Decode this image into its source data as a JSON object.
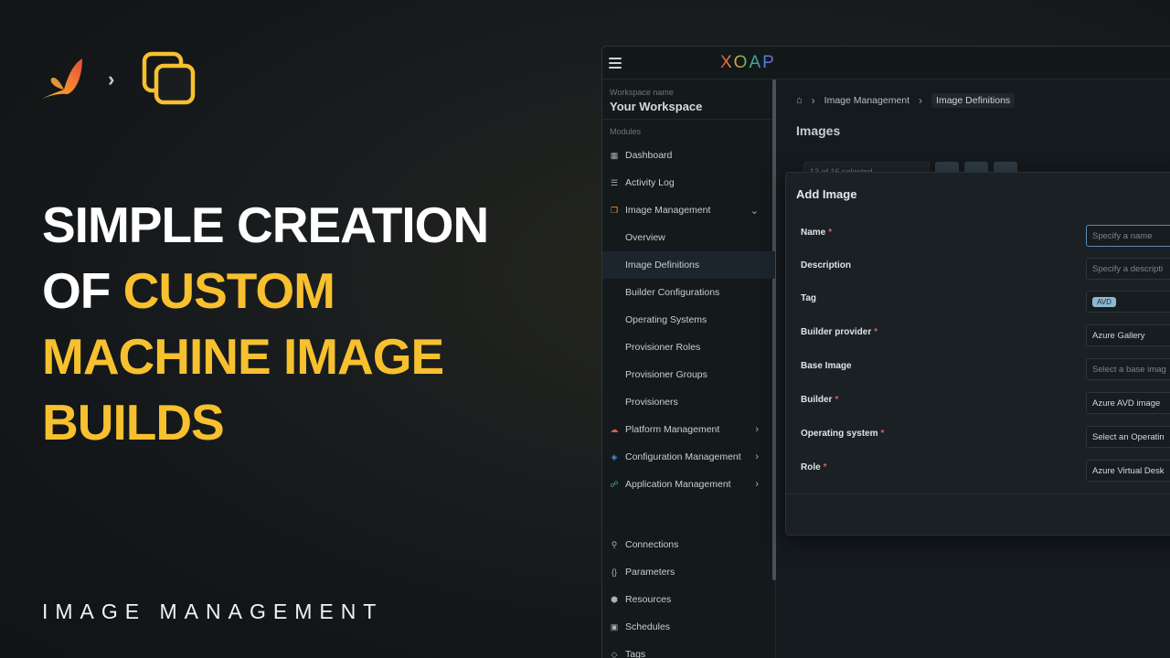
{
  "hero": {
    "title_line1": "SIMPLE CREATION",
    "title_line2_white": "OF ",
    "title_line2_yellow": "CUSTOM",
    "title_line3": "MACHINE IMAGE",
    "title_line4": "BUILDS",
    "subtitle": "IMAGE MANAGEMENT",
    "accent_color": "#f7c02e",
    "icons": [
      "butterfly-logo-icon",
      "chevron-right-icon",
      "copy-stack-icon"
    ]
  },
  "app": {
    "logo": "XOAP",
    "workspace_label": "Workspace name",
    "workspace_name": "Your Workspace",
    "modules_label": "Modules",
    "nav": [
      {
        "label": "Dashboard",
        "icon": "grid-icon"
      },
      {
        "label": "Activity Log",
        "icon": "list-icon"
      },
      {
        "label": "Image Management",
        "icon": "copy-icon",
        "expanded": true
      }
    ],
    "sub_nav": [
      "Overview",
      "Image Definitions",
      "Builder Configurations",
      "Operating Systems",
      "Provisioner Roles",
      "Provisioner Groups",
      "Provisioners"
    ],
    "nav_more": [
      {
        "label": "Platform Management",
        "icon": "cloud-icon"
      },
      {
        "label": "Configuration Management",
        "icon": "layers-icon"
      },
      {
        "label": "Application Management",
        "icon": "share-icon"
      }
    ],
    "nav_bottom": [
      {
        "label": "Connections",
        "icon": "pin-icon"
      },
      {
        "label": "Parameters",
        "icon": "braces-icon"
      },
      {
        "label": "Resources",
        "icon": "cube-icon"
      },
      {
        "label": "Schedules",
        "icon": "calendar-icon"
      },
      {
        "label": "Tags",
        "icon": "tag-icon"
      }
    ],
    "breadcrumbs": [
      "Image Management",
      "Image Definitions"
    ],
    "page_title": "Images",
    "selection": "13 of 16 selected"
  },
  "modal": {
    "title": "Add Image",
    "fields": [
      {
        "label": "Name",
        "required": true,
        "value": "Specify a name",
        "placeholder": true
      },
      {
        "label": "Description",
        "required": false,
        "value": "Specify a descripti",
        "placeholder": true
      },
      {
        "label": "Tag",
        "required": false,
        "value": "AVD",
        "chip": true
      },
      {
        "label": "Builder provider",
        "required": true,
        "value": "Azure Gallery"
      },
      {
        "label": "Base Image",
        "required": false,
        "value": "Select a base imag",
        "placeholder": true
      },
      {
        "label": "Builder",
        "required": true,
        "value": "Azure AVD image"
      },
      {
        "label": "Operating system",
        "required": true,
        "value": "Select an Operatin"
      },
      {
        "label": "Role",
        "required": true,
        "value": "Azure Virtual Desk"
      }
    ]
  }
}
